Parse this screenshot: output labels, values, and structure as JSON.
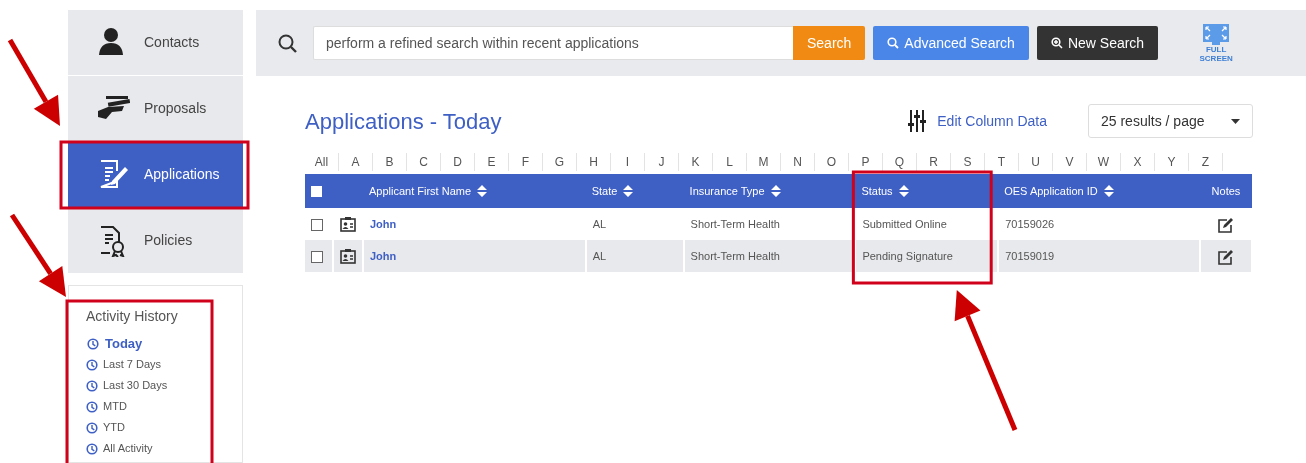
{
  "sidebar": {
    "items": [
      {
        "label": "Contacts",
        "selected": false,
        "highlighted": false
      },
      {
        "label": "Proposals",
        "selected": false,
        "highlighted": false
      },
      {
        "label": "Applications",
        "selected": true,
        "highlighted": true
      },
      {
        "label": "Policies",
        "selected": false,
        "highlighted": false
      }
    ],
    "activity_history": {
      "title": "Activity History",
      "highlighted": true,
      "items": [
        {
          "label": "Today",
          "selected": true
        },
        {
          "label": "Last 7 Days",
          "selected": false
        },
        {
          "label": "Last 30 Days",
          "selected": false
        },
        {
          "label": "MTD",
          "selected": false
        },
        {
          "label": "YTD",
          "selected": false
        },
        {
          "label": "All Activity",
          "selected": false
        }
      ]
    }
  },
  "search": {
    "placeholder": "perform a refined search within recent applications",
    "buttons": [
      {
        "label": "Search",
        "kind": "submit"
      },
      {
        "label": "Advanced Search",
        "kind": "advanced"
      },
      {
        "label": "New Search",
        "kind": "new"
      }
    ],
    "fullscreen_label": "FULL SCREEN"
  },
  "title": "Applications - Today",
  "edit_columns": "Edit Column Data",
  "page_size": "25 results / page",
  "letters": [
    "All",
    "A",
    "B",
    "C",
    "D",
    "E",
    "F",
    "G",
    "H",
    "I",
    "J",
    "K",
    "L",
    "M",
    "N",
    "O",
    "P",
    "Q",
    "R",
    "S",
    "T",
    "U",
    "V",
    "W",
    "X",
    "Y",
    "Z"
  ],
  "table": {
    "select_all_checked": false,
    "columns": [
      {
        "label": "Applicant First Name",
        "sortable": true,
        "highlighted": false
      },
      {
        "label": "State",
        "sortable": true,
        "highlighted": false
      },
      {
        "label": "Insurance Type",
        "sortable": true,
        "highlighted": false
      },
      {
        "label": "Status",
        "sortable": true,
        "highlighted": true
      },
      {
        "label": "OES Application ID",
        "sortable": true,
        "highlighted": false
      },
      {
        "label": "Notes",
        "sortable": false,
        "highlighted": false
      }
    ],
    "rows": [
      {
        "checked": false,
        "name": "John",
        "state": "AL",
        "insurance_type": "Short-Term Health",
        "status": "Submitted Online",
        "id": "70159026"
      },
      {
        "checked": false,
        "name": "John",
        "state": "AL",
        "insurance_type": "Short-Term Health",
        "status": "Pending Signature",
        "id": "70159019"
      }
    ]
  }
}
